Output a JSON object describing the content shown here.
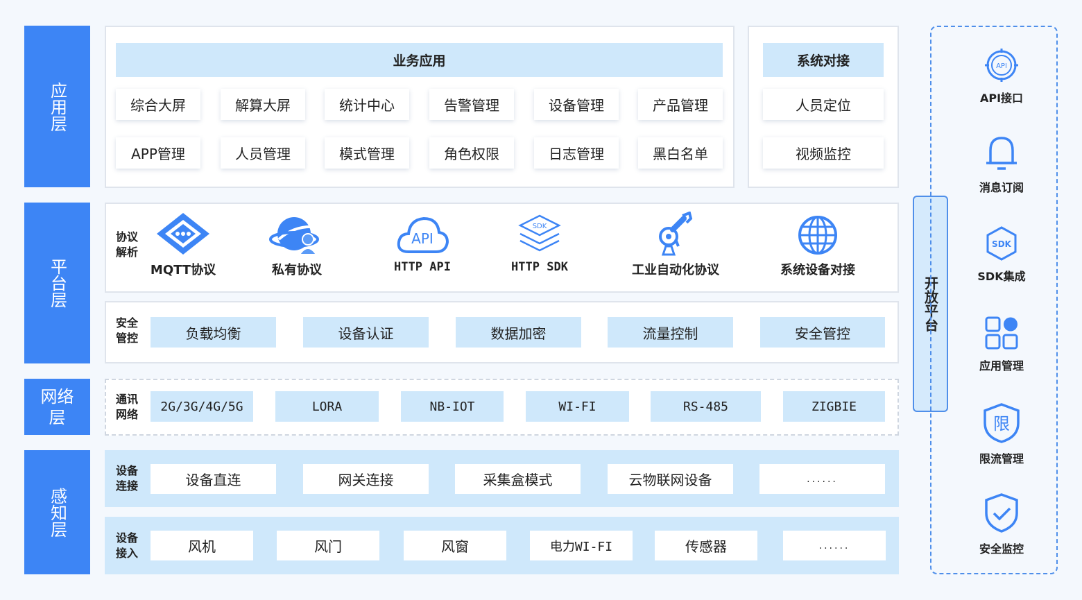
{
  "layers": {
    "app": "应用层",
    "platform": "平台层",
    "network": "网络层",
    "perception": "感知层"
  },
  "app": {
    "business_title": "业务应用",
    "business_items": [
      "综合大屏",
      "解算大屏",
      "统计中心",
      "告警管理",
      "设备管理",
      "产品管理",
      "APP管理",
      "人员管理",
      "模式管理",
      "角色权限",
      "日志管理",
      "黑白名单"
    ],
    "system_title": "系统对接",
    "system_items": [
      "人员定位",
      "视频监控"
    ]
  },
  "platform": {
    "protocol_label": "协议解析",
    "protocols": [
      {
        "name": "MQTT协议",
        "icon": "mqtt-icon"
      },
      {
        "name": "私有协议",
        "icon": "private-protocol-icon"
      },
      {
        "name": "HTTP API",
        "icon": "cloud-api-icon",
        "icon_text": "API"
      },
      {
        "name": "HTTP SDK",
        "icon": "sdk-layers-icon",
        "icon_text": "SDK"
      },
      {
        "name": "工业自动化协议",
        "icon": "robot-arm-icon"
      },
      {
        "name": "系统设备对接",
        "icon": "globe-icon"
      }
    ],
    "security_label": "安全管控",
    "security_items": [
      "负载均衡",
      "设备认证",
      "数据加密",
      "流量控制",
      "安全管控"
    ]
  },
  "network": {
    "label": "通讯网络",
    "items": [
      "2G/3G/4G/5G",
      "LORA",
      "NB-IOT",
      "WI-FI",
      "RS-485",
      "ZIGBIE"
    ]
  },
  "perception": {
    "connect_label": "设备连接",
    "connect_items": [
      "设备直连",
      "网关连接",
      "采集盒模式",
      "云物联网设备",
      "......"
    ],
    "access_label": "设备接入",
    "access_items": [
      "风机",
      "风门",
      "风窗",
      "电力WI-FI",
      "传感器",
      "......"
    ]
  },
  "open_platform": "开放平台",
  "right_items": [
    {
      "label": "API接口",
      "icon": "api-icon",
      "icon_text": "API"
    },
    {
      "label": "消息订阅",
      "icon": "bell-icon"
    },
    {
      "label": "SDK集成",
      "icon": "sdk-icon",
      "icon_text": "SDK"
    },
    {
      "label": "应用管理",
      "icon": "app-grid-icon"
    },
    {
      "label": "限流管理",
      "icon": "shield-limit-icon",
      "icon_text": "限"
    },
    {
      "label": "安全监控",
      "icon": "shield-check-icon"
    }
  ],
  "colors": {
    "layer_blue": "#3d85f5",
    "light_blue": "#cfe8fb",
    "icon_blue": "#3d85f5",
    "border_blue": "#4f8fea"
  }
}
